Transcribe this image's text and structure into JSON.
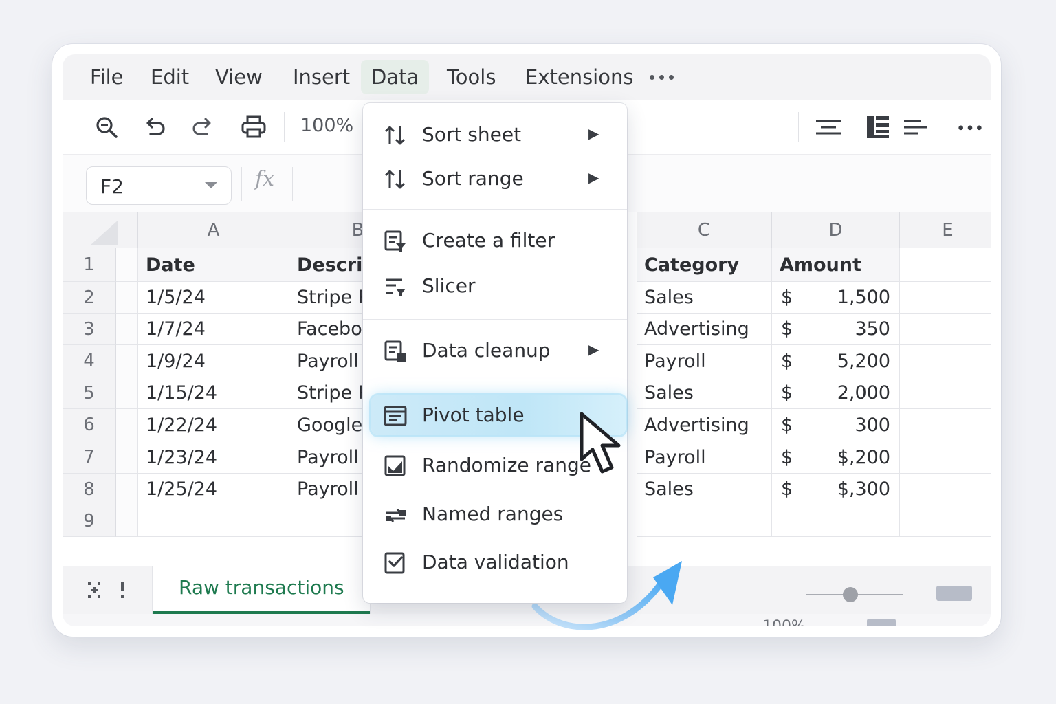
{
  "menubar": {
    "items": [
      {
        "label": "File"
      },
      {
        "label": "Edit"
      },
      {
        "label": "View"
      },
      {
        "label": "Insert"
      },
      {
        "label": "Data",
        "active": true
      },
      {
        "label": "Tools"
      },
      {
        "label": "Extensions"
      }
    ],
    "more_icon": "more-horizontal-icon"
  },
  "toolbar": {
    "icons": [
      "search-icon",
      "undo-icon",
      "redo-icon",
      "print-icon"
    ],
    "zoom": "100%",
    "right_icons": [
      "align-center-icon",
      "borders-icon",
      "align-left-icon",
      "more-horizontal-icon"
    ]
  },
  "formula_bar": {
    "cell_ref": "F2",
    "fx_label": "fx"
  },
  "grid": {
    "columns": [
      "A",
      "B",
      "C",
      "D",
      "E"
    ],
    "rows": [
      "1",
      "2",
      "3",
      "4",
      "5",
      "6",
      "7",
      "8",
      "9"
    ],
    "header_row": {
      "a": "Date",
      "b": "Descrip",
      "c": "Category",
      "d": "Amount"
    },
    "data_rows": [
      {
        "date": "1/5/24",
        "desc": "Stripe P",
        "category": "Sales",
        "currency": "$",
        "amount": "1,500"
      },
      {
        "date": "1/7/24",
        "desc": "Facebo",
        "category": "Advertising",
        "currency": "$",
        "amount": "350"
      },
      {
        "date": "1/9/24",
        "desc": "Payroll",
        "category": "Payroll",
        "currency": "$",
        "amount": "5,200"
      },
      {
        "date": "1/15/24",
        "desc": "Stripe P",
        "category": "Sales",
        "currency": "$",
        "amount": "2,000"
      },
      {
        "date": "1/22/24",
        "desc": "Google",
        "category": "Advertising",
        "currency": "$",
        "amount": "300"
      },
      {
        "date": "1/23/24",
        "desc": "Payroll",
        "category": "Payroll",
        "currency": "$",
        "amount": "$,200"
      },
      {
        "date": "1/25/24",
        "desc": "Payroll (",
        "category": "Sales",
        "currency": "$",
        "amount": "$,300"
      }
    ]
  },
  "sheets": {
    "active_tab": "Raw transactions"
  },
  "status": {
    "zoom": "100%"
  },
  "data_menu": {
    "items": [
      {
        "label": "Sort sheet",
        "icon": "sort-icon",
        "submenu": true
      },
      {
        "label": "Sort range",
        "icon": "sort-icon",
        "submenu": true
      },
      {
        "label": "Create a filter",
        "icon": "filter-icon",
        "submenu": false
      },
      {
        "label": "Slicer",
        "icon": "slicer-icon",
        "submenu": false
      },
      {
        "label": "Data cleanup",
        "icon": "data-cleanup-icon",
        "submenu": true
      },
      {
        "label": "Pivot table",
        "icon": "pivot-table-icon",
        "submenu": false,
        "highlighted": true
      },
      {
        "label": "Randomize range",
        "icon": "randomize-icon",
        "submenu": false
      },
      {
        "label": "Named ranges",
        "icon": "named-ranges-icon",
        "submenu": false
      },
      {
        "label": "Data validation",
        "icon": "data-validation-icon",
        "submenu": false
      }
    ],
    "submenu_glyph": "▶"
  },
  "colors": {
    "accent_green": "#1e7a4f",
    "highlight_blue": "#bfe6f7",
    "arrow_blue": "#5aaef0"
  }
}
